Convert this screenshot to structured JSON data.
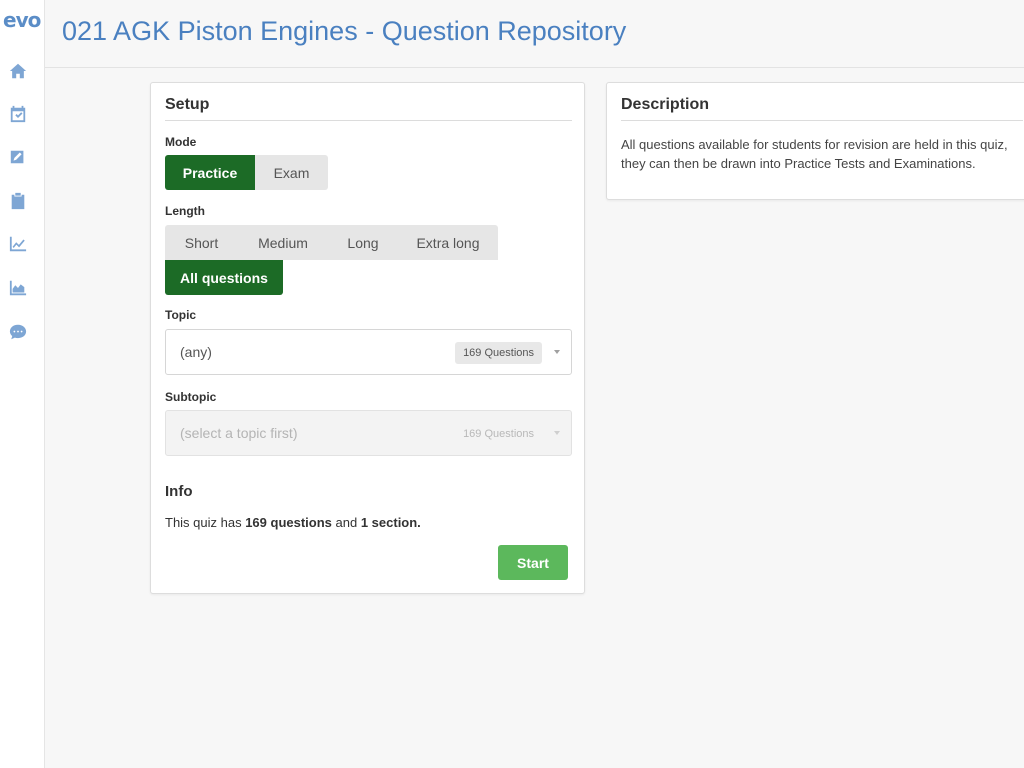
{
  "sidebar": {
    "logo": "evo",
    "icons": [
      "home-icon",
      "calendar-check-icon",
      "edit-square-icon",
      "clipboard-icon",
      "line-chart-icon",
      "area-chart-icon",
      "chat-icon"
    ]
  },
  "header": {
    "title": "021 AGK Piston Engines - Question Repository"
  },
  "setup": {
    "title": "Setup",
    "mode": {
      "label": "Mode",
      "options": [
        "Practice",
        "Exam"
      ],
      "selected": "Practice"
    },
    "length": {
      "label": "Length",
      "options": [
        "Short",
        "Medium",
        "Long",
        "Extra long",
        "All questions"
      ],
      "selected": "All questions"
    },
    "topic": {
      "label": "Topic",
      "value": "(any)",
      "badge": "169 Questions"
    },
    "subtopic": {
      "label": "Subtopic",
      "value": "(select a topic first)",
      "badge": "169 Questions"
    },
    "info": {
      "title": "Info",
      "prefix": "This quiz has ",
      "questions": "169 questions",
      "middle": " and ",
      "sections": "1 section."
    },
    "start_label": "Start"
  },
  "description": {
    "title": "Description",
    "text": "All questions available for students for revision are held in this quiz, they can then be drawn into Practice Tests and Examinations."
  },
  "colors": {
    "accent": "#4a80c0",
    "active_green": "#1c6b26",
    "start_green": "#5cb85c"
  }
}
